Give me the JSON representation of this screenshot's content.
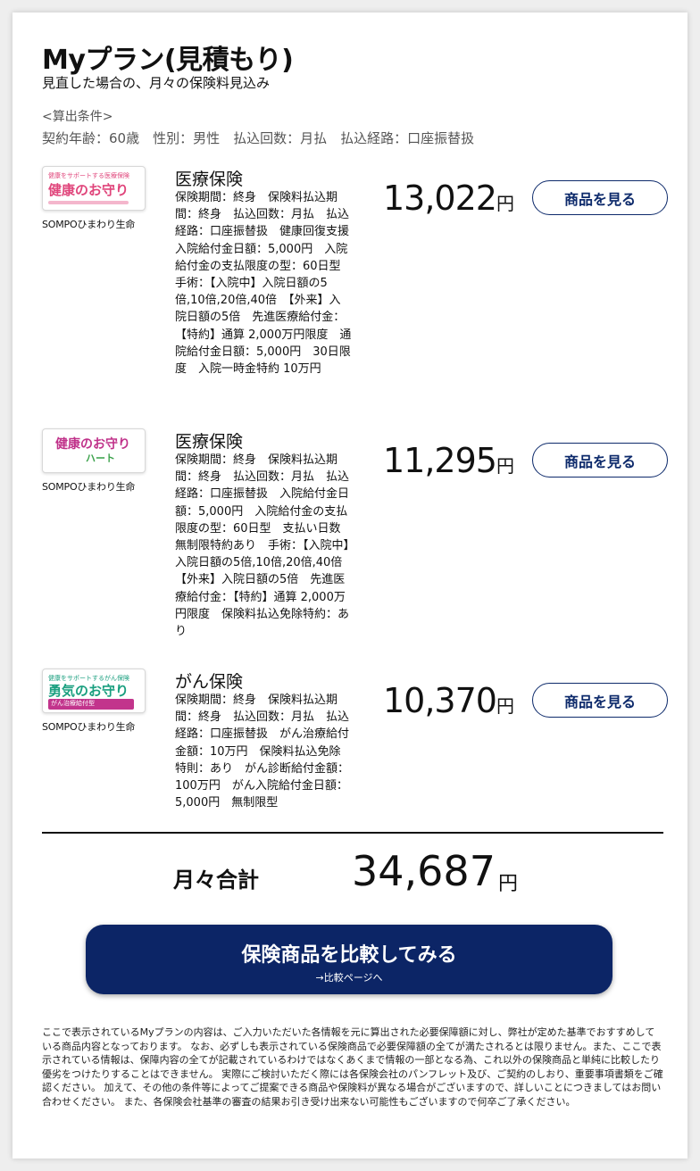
{
  "header": {
    "title": "Myプラン(見積もり)",
    "subtitle": "見直した場合の、月々の保険料見込み",
    "conditions_heading": "<算出条件>",
    "conditions": "契約年齢：60歳　性別：男性　払込回数：月払　払込経路：口座振替扱"
  },
  "plans": [
    {
      "logo_line1": "健康をサポートする医療保険",
      "logo_name": "健康のお守り",
      "logo_tag": "",
      "company": "SOMPOひまわり生命",
      "name": "医療保険",
      "description": "保険期間：終身　保険料払込期間：終身　払込回数：月払　払込経路：口座振替扱　健康回復支援　入院給付金日額：5,000円　入院給付金の支払限度の型：60日型　手術：【入院中】入院日額の5倍,10倍,20倍,40倍　【外来】入院日額の5倍　先進医療給付金：【特約】通算 2,000万円限度　通院給付金日額：5,000円　30日限度　入院一時金特約 10万円",
      "price": "13,022",
      "yen": "円",
      "button": "商品を見る"
    },
    {
      "logo_line1": "",
      "logo_name": "健康のお守り",
      "logo_tag": "ハート",
      "company": "SOMPOひまわり生命",
      "name": "医療保険",
      "description": "保険期間：終身　保険料払込期間：終身　払込回数：月払　払込経路：口座振替扱　入院給付金日額：5,000円　入院給付金の支払限度の型：60日型　支払い日数無制限特約あり　手術：【入院中】入院日額の5倍,10倍,20倍,40倍 【外来】入院日額の5倍　先進医療給付金：【特約】通算 2,000万円限度　保険料払込免除特約：あり",
      "price": "11,295",
      "yen": "円",
      "button": "商品を見る"
    },
    {
      "logo_line1": "健康をサポートするがん保険",
      "logo_name": "勇気のお守り",
      "logo_tag": "がん治療給付型",
      "company": "SOMPOひまわり生命",
      "name": "がん保険",
      "description": "保険期間：終身　保険料払込期間：終身　払込回数：月払　払込経路：口座振替扱　がん治療給付金額：10万円　保険料払込免除特則：あり　がん診断給付金額：100万円　がん入院給付金日額：5,000円　無制限型",
      "price": "10,370",
      "yen": "円",
      "button": "商品を見る"
    }
  ],
  "total": {
    "label": "月々合計",
    "value": "34,687",
    "yen": "円"
  },
  "cta": {
    "main": "保険商品を比較してみる",
    "sub": "→比較ページへ"
  },
  "disclaimer": "ここで表示されているMyプランの内容は、ご入力いただいた各情報を元に算出された必要保障額に対し、弊社が定めた基準でおすすめしている商品内容となっております。 なお、必ずしも表示されている保険商品で必要保障額の全てが満たされるとは限りません。また、ここで表示されている情報は、保障内容の全てが記載されているわけではなくあくまで情報の一部となる為、これ以外の保険商品と単純に比較したり優劣をつけたりすることはできません。 実際にご検討いただく際には各保険会社のパンフレット及び、ご契約のしおり、重要事項書類をご確認ください。 加えて、その他の条件等によってご提案できる商品や保険料が異なる場合がございますので、詳しいことにつきましてはお問い合わせください。 また、各保険会社基準の審査の結果お引き受け出来ない可能性もございますので何卒ご了承ください。",
  "colors": {
    "navy": "#0c2566",
    "logo1_text": "#e0457b",
    "logo2_text": "#c0328a",
    "logo3_text": "#1a9f7f",
    "logo3_tag": "#c2348c"
  }
}
